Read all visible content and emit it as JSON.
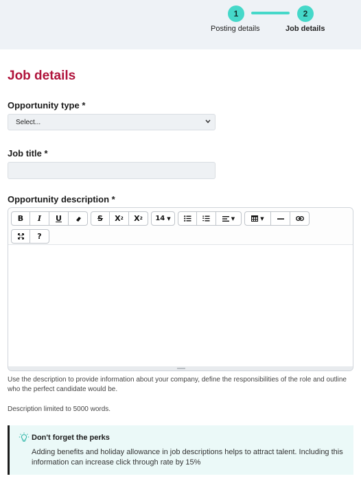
{
  "stepper": {
    "steps": [
      {
        "number": "1",
        "label": "Posting details"
      },
      {
        "number": "2",
        "label": "Job details"
      }
    ],
    "accent": "#45d8c9"
  },
  "page": {
    "title": "Job details",
    "title_color": "#b0143c"
  },
  "fields": {
    "opportunity_type": {
      "label": "Opportunity type *",
      "value": "Select..."
    },
    "job_title": {
      "label": "Job title *",
      "value": ""
    },
    "description": {
      "label": "Opportunity description *"
    }
  },
  "toolbar": {
    "bold": "B",
    "italic": "I",
    "underline": "U",
    "eraser_icon": "eraser-icon",
    "strike": "S",
    "superscript": "X",
    "subscript": "X",
    "font_size": "14",
    "bullet_list_icon": "bullet-list-icon",
    "numbered_list_icon": "numbered-list-icon",
    "align_icon": "align-icon",
    "table_icon": "table-icon",
    "hr_icon": "horizontal-rule-icon",
    "link_icon": "link-icon",
    "fullscreen_icon": "fullscreen-icon",
    "help": "?"
  },
  "help": {
    "description_hint": "Use the description to provide information about your company, define the responsibilities of the role and outline who the perfect candidate would be.",
    "limit": "Description limited to 5000 words."
  },
  "perks": {
    "title": "Don't forget the perks",
    "body": "Adding benefits and holiday allowance in job descriptions helps to attract talent. Including this information can increase click through rate by 15%",
    "icon": "lightbulb-icon"
  }
}
